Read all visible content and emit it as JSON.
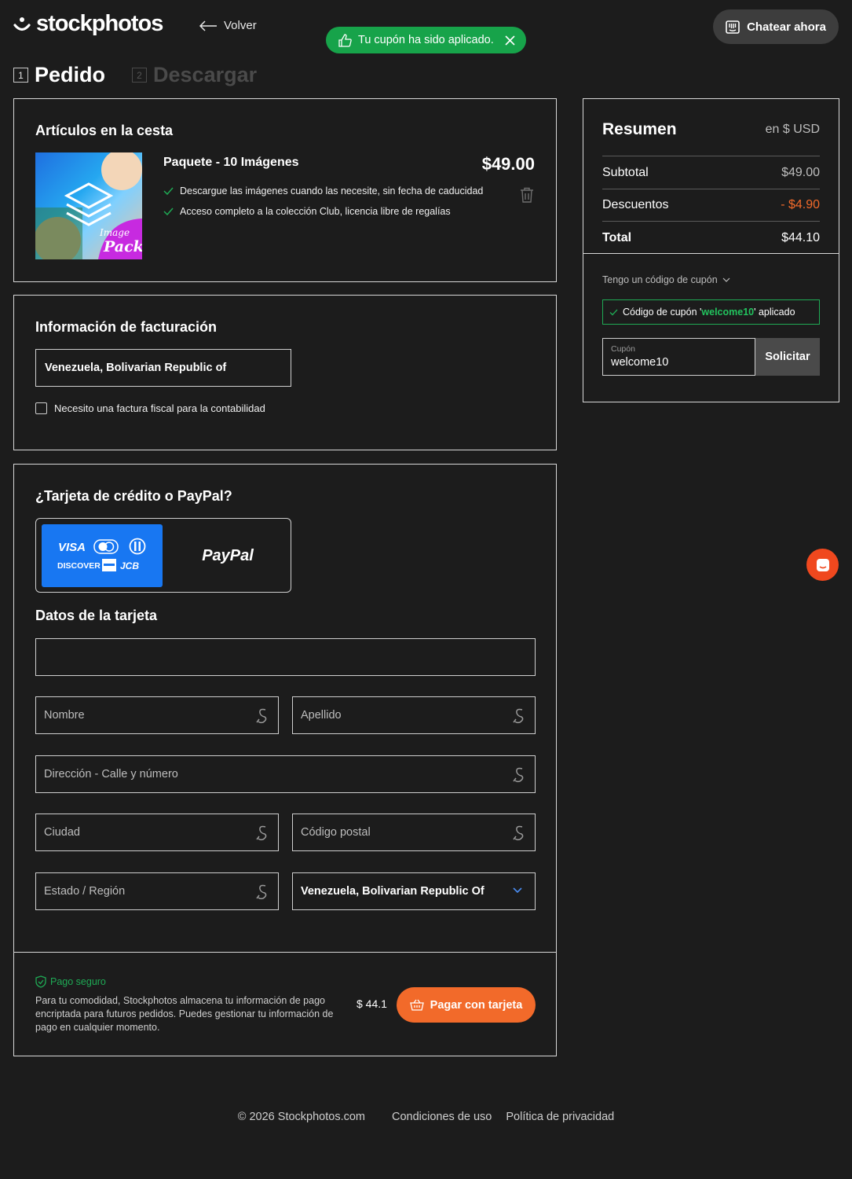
{
  "header": {
    "logo_text": "stockphotos",
    "back_label": "Volver",
    "toast": "Tu cupón ha sido aplicado.",
    "chat_label": "Chatear ahora"
  },
  "steps": [
    {
      "num": "1",
      "label": "Pedido"
    },
    {
      "num": "2",
      "label": "Descargar"
    }
  ],
  "basket": {
    "title": "Artículos en la cesta",
    "item_title": "Paquete - 10 Imágenes",
    "price": "$49.00",
    "image_caption_top": "Image",
    "image_caption_bottom": "Pack",
    "features": [
      "Descargue las imágenes cuando las necesite, sin fecha de caducidad",
      "Acceso completo a la colección Club, licencia libre de regalías"
    ]
  },
  "billing": {
    "title": "Información de facturación",
    "country": "Venezuela, Bolivarian Republic of",
    "invoice_label": "Necesito una factura fiscal para la contabilidad"
  },
  "payment": {
    "title": "¿Tarjeta de crédito o PayPal?",
    "card_brands": [
      "VISA",
      "DISCOVER",
      "JCB"
    ],
    "paypal_label": "PayPal",
    "card_details_title": "Datos de la tarjeta",
    "fields": {
      "first_name": "Nombre",
      "last_name": "Apellido",
      "address": "Dirección - Calle y número",
      "city": "Ciudad",
      "postal": "Código postal",
      "state": "Estado / Región",
      "country": "Venezuela, Bolivarian Republic Of"
    },
    "secure_label": "Pago seguro",
    "secure_text": "Para tu comodidad, Stockphotos almacena tu información de pago encriptada para futuros pedidos. Puedes gestionar tu información de pago en cualquier momento.",
    "amount": "$ 44.1",
    "pay_label": "Pagar con tarjeta"
  },
  "summary": {
    "title": "Resumen",
    "currency": "en $ USD",
    "subtotal_label": "Subtotal",
    "subtotal_value": "$49.00",
    "discount_label": "Descuentos",
    "discount_value": "- $4.90",
    "total_label": "Total",
    "total_value": "$44.10",
    "coupon_toggle": "Tengo un código de cupón",
    "coupon_applied_prefix": "Código de cupón '",
    "coupon_code": "welcome10",
    "coupon_applied_suffix": "' aplicado",
    "coupon_field_label": "Cupón",
    "coupon_field_value": "welcome10",
    "apply_label": "Solicitar"
  },
  "footer": {
    "copyright": "© 2026 Stockphotos.com",
    "terms": "Condiciones de uso",
    "privacy": "Política de privacidad"
  },
  "colors": {
    "background": "#1c1c1c",
    "success": "#17a34a",
    "accent_orange": "#f26a2a",
    "card_blue": "#1877f2",
    "discount": "#f26a2a"
  }
}
